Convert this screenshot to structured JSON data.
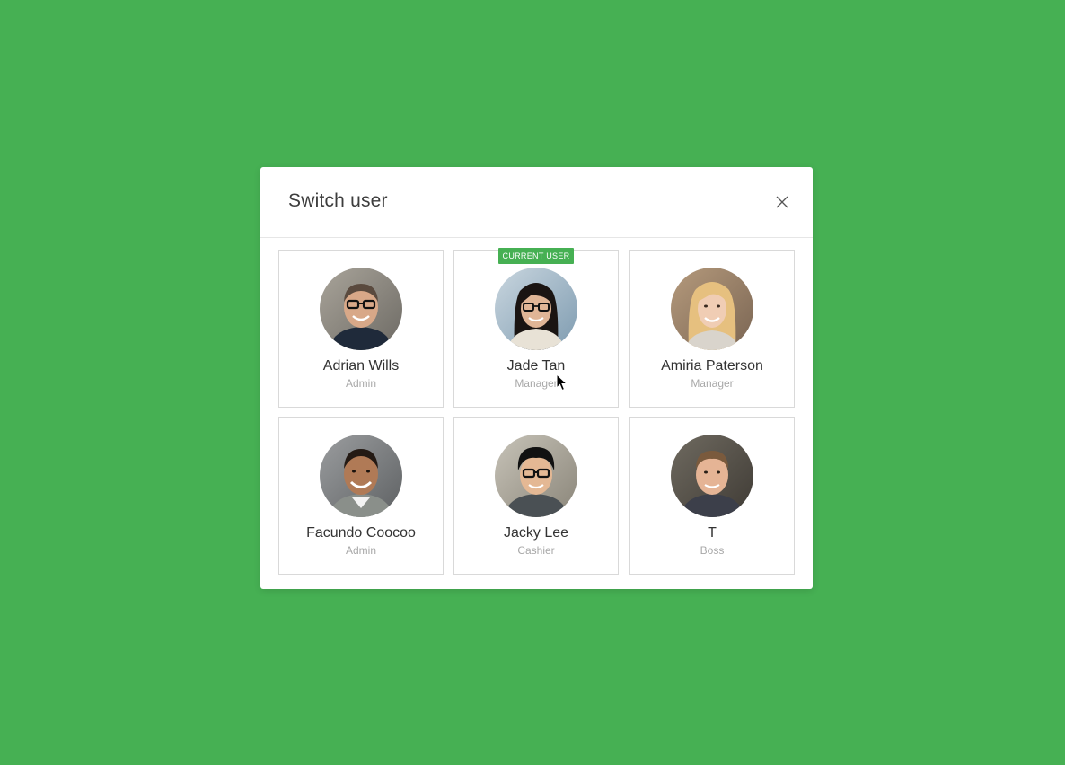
{
  "modal": {
    "title": "Switch user"
  },
  "users": [
    {
      "name": "Adrian Wills",
      "role": "Admin",
      "current": false
    },
    {
      "name": "Jade Tan",
      "role": "Manager",
      "current": true
    },
    {
      "name": "Amiria Paterson",
      "role": "Manager",
      "current": false
    },
    {
      "name": "Facundo Coocoo",
      "role": "Admin",
      "current": false
    },
    {
      "name": "Jacky Lee",
      "role": "Cashier",
      "current": false
    },
    {
      "name": "T",
      "role": "Boss",
      "current": false
    }
  ],
  "badge": {
    "current_label": "CURRENT USER"
  },
  "colors": {
    "background": "#46b053",
    "badge": "#46b053",
    "border": "#d9d9d9"
  }
}
